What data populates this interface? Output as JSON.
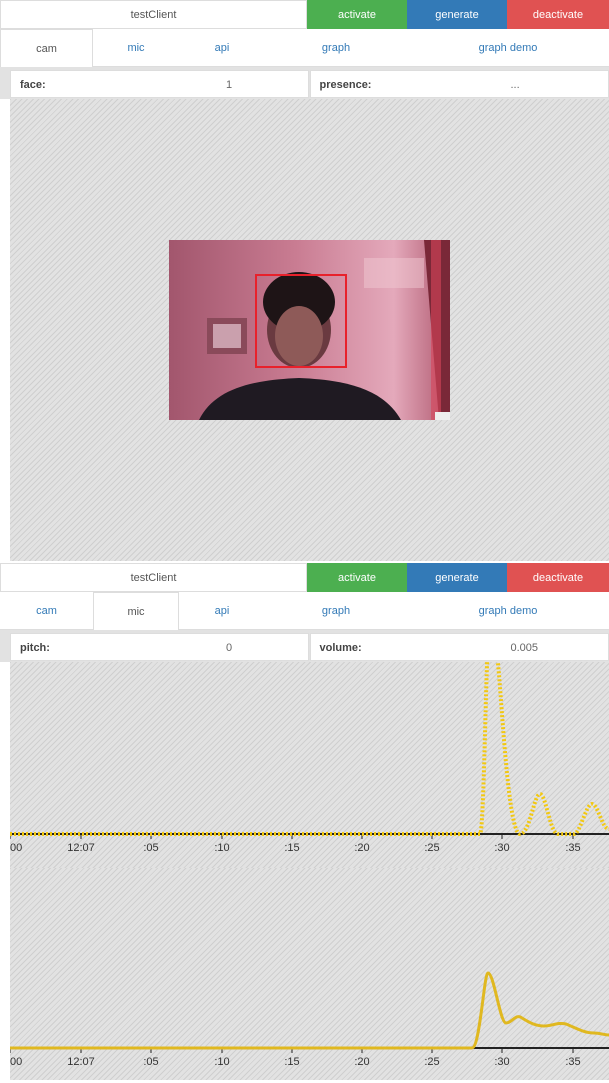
{
  "panel1": {
    "client": "testClient",
    "buttons": {
      "activate": "activate",
      "generate": "generate",
      "deactivate": "deactivate"
    },
    "tabs": [
      "cam",
      "mic",
      "api",
      "graph",
      "graph demo"
    ],
    "active_tab": "cam",
    "info": {
      "left_label": "face:",
      "left_value": "1",
      "right_label": "presence:",
      "right_value": "..."
    }
  },
  "panel2": {
    "client": "testClient",
    "buttons": {
      "activate": "activate",
      "generate": "generate",
      "deactivate": "deactivate"
    },
    "tabs": [
      "cam",
      "mic",
      "api",
      "graph",
      "graph demo"
    ],
    "active_tab": "mic",
    "info": {
      "left_label": "pitch:",
      "left_value": "0",
      "right_label": "volume:",
      "right_value": "0.005"
    }
  },
  "axis_ticks": [
    "00",
    "12:07",
    ":05",
    ":10",
    ":15",
    ":20",
    ":25",
    ":30",
    ":35"
  ],
  "colors": {
    "activate": "#4caf50",
    "generate": "#337ab7",
    "deactivate": "#e05252",
    "series": "#f2c811",
    "face_box": "#e8212b"
  },
  "chart_data": [
    {
      "type": "line",
      "series_color": "#f2c811",
      "x_ticks": [
        "00",
        "12:07",
        ":05",
        ":10",
        ":15",
        ":20",
        ":25",
        ":30",
        ":35"
      ]
    },
    {
      "type": "line",
      "series_color": "#e0b820",
      "x_ticks": [
        "00",
        "12:07",
        ":05",
        ":10",
        ":15",
        ":20",
        ":25",
        ":30",
        ":35"
      ]
    }
  ]
}
